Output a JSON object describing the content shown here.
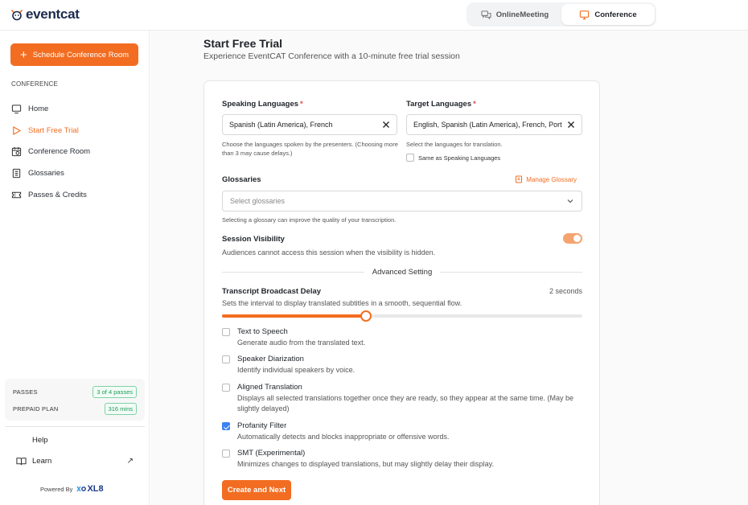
{
  "app": {
    "logo_text": "eventcat"
  },
  "header": {
    "tabs": [
      {
        "label": "OnlineMeeting",
        "icon": "chat-bubbles-icon",
        "active": false
      },
      {
        "label": "Conference",
        "icon": "monitor-icon",
        "active": true
      }
    ]
  },
  "sidebar": {
    "cta_label": "Schedule Conference Room",
    "section_label": "CONFERENCE",
    "items": [
      {
        "label": "Home",
        "icon": "monitor-icon",
        "active": false
      },
      {
        "label": "Start Free Trial",
        "icon": "play-icon",
        "active": true
      },
      {
        "label": "Conference Room",
        "icon": "calendar-icon",
        "active": false
      },
      {
        "label": "Glossaries",
        "icon": "book-icon",
        "active": false
      },
      {
        "label": "Passes & Credits",
        "icon": "ticket-icon",
        "active": false
      }
    ],
    "passes": {
      "label": "PASSES",
      "value": "3 of 4 passes"
    },
    "prepaid": {
      "label": "PREPAID PLAN",
      "value": "316 mins"
    },
    "help_label": "Help",
    "learn_label": "Learn",
    "powered_by": "Powered By",
    "powered_brand": "XL8"
  },
  "main": {
    "title": "Start Free Trial",
    "subtitle": "Experience EventCAT Conference with a 10-minute free trial session"
  },
  "form": {
    "speaking": {
      "label": "Speaking Languages",
      "value": "Spanish (Latin America), French",
      "help": "Choose the languages spoken by the presenters. (Choosing more than 3 may cause delays.)"
    },
    "target": {
      "label": "Target Languages",
      "value": "English, Spanish (Latin America), French, Portuguese",
      "help": "Select the languages for translation.",
      "same_as_label": "Same as Speaking Languages",
      "same_as_checked": false
    },
    "required_mark": "*",
    "glossaries": {
      "label": "Glossaries",
      "manage_label": "Manage Glossary",
      "placeholder": "Select glossaries",
      "help": "Selecting a glossary can improve the quality of your transcription."
    },
    "visibility": {
      "label": "Session Visibility",
      "help": "Audiences cannot access this session when the visibility is hidden.",
      "enabled": true
    },
    "advanced_label": "Advanced Setting",
    "delay": {
      "label": "Transcript Broadcast Delay",
      "value_text": "2 seconds",
      "help": "Sets the interval to display translated subtitles in a smooth, sequential flow.",
      "fraction": 0.4
    },
    "options": [
      {
        "title": "Text to Speech",
        "desc": "Generate audio from the translated text.",
        "checked": false
      },
      {
        "title": "Speaker Diarization",
        "desc": "Identify individual speakers by voice.",
        "checked": false
      },
      {
        "title": "Aligned Translation",
        "desc": "Displays all selected translations together once they are ready, so they appear at the same time. (May be slightly delayed)",
        "checked": false
      },
      {
        "title": "Profanity Filter",
        "desc": "Automatically detects and blocks inappropriate or offensive words.",
        "checked": true
      },
      {
        "title": "SMT (Experimental)",
        "desc": "Minimizes changes to displayed translations, but may slightly delay their display.",
        "checked": false
      }
    ],
    "submit_label": "Create and Next"
  },
  "colors": {
    "accent": "#f26d21",
    "success": "#1a9c5a",
    "checkbox": "#3b82f6"
  }
}
